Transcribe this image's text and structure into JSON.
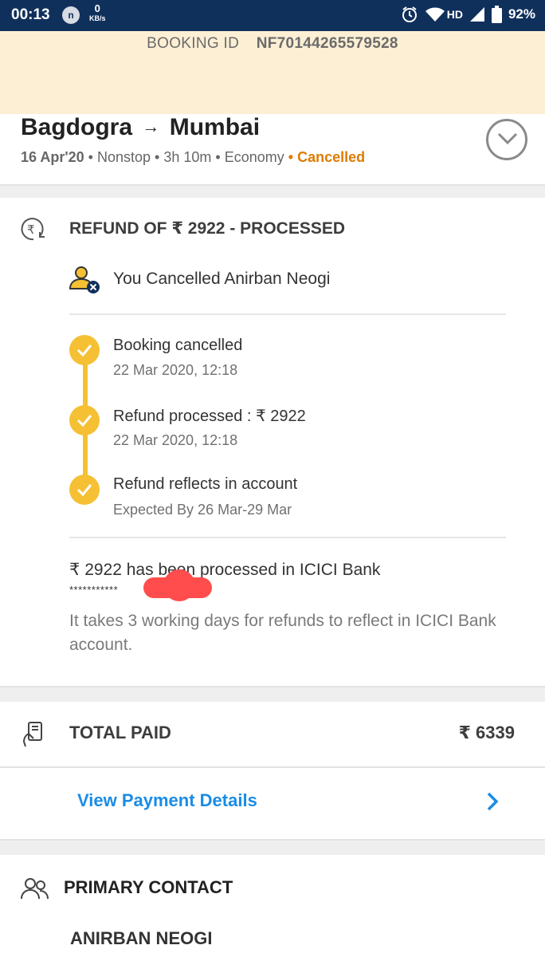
{
  "status_bar": {
    "time": "00:13",
    "notif_badge": "n",
    "data_speed_value": "0",
    "data_speed_unit": "KB/s",
    "network": "HD",
    "battery": "92%"
  },
  "booking": {
    "id_label": "BOOKING ID",
    "id_value": "NF70144265579528"
  },
  "trip": {
    "from": "Bagdogra",
    "arrow": "→",
    "to": "Mumbai",
    "date": "16 Apr'20",
    "stops": "Nonstop",
    "duration": "3h 10m",
    "cabin": "Economy",
    "status": "Cancelled"
  },
  "refund": {
    "title": "REFUND OF ₹ 2922 - PROCESSED",
    "cancelled_by": "You Cancelled Anirban Neogi",
    "steps": [
      {
        "title": "Booking cancelled",
        "subtitle": "22 Mar 2020, 12:18"
      },
      {
        "title": "Refund processed : ₹ 2922",
        "subtitle": "22 Mar 2020, 12:18"
      },
      {
        "title": "Refund reflects in account",
        "subtitle": "Expected By 26 Mar-29 Mar"
      }
    ],
    "processed_text": "₹ 2922 has been processed in ICICI Bank",
    "masked_account": "***********",
    "info": "It takes 3 working days for refunds to reflect in ICICI Bank account."
  },
  "payment": {
    "total_label": "TOTAL PAID",
    "total_amount": "₹ 6339",
    "view_details": "View Payment Details"
  },
  "contact": {
    "label": "PRIMARY CONTACT",
    "name": "ANIRBAN NEOGI"
  },
  "colors": {
    "status_bar": "#10305c",
    "booking_band": "#fcefd4",
    "accent_yellow": "#f5c033",
    "cancelled_orange": "#e07b00",
    "link_blue": "#1a8ce6"
  }
}
